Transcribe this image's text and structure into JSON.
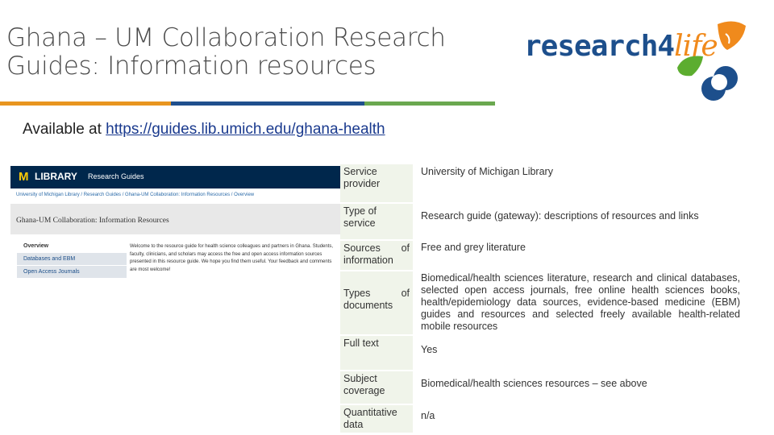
{
  "slide": {
    "title_line1": "Ghana – UM Collaboration Research",
    "title_line2": "Guides: Information resources",
    "available_prefix": "Available at ",
    "available_link": "https://guides.lib.umich.edu/ghana-health"
  },
  "logo": {
    "text_main": "research4",
    "text_accent": "life",
    "icon": "leaf-flower-icon"
  },
  "colors": {
    "rule_orange": "#e8951f",
    "rule_blue": "#1f4f8d",
    "rule_green": "#6aa84f",
    "library_navy": "#00274c",
    "library_maize": "#ffcb05"
  },
  "library_site": {
    "brand_m": "M",
    "brand_library": "LIBRARY",
    "brand_section": "Research Guides",
    "breadcrumb": "University of Michigan Library  /  Research Guides  /  Ghana-UM Collaboration: Information Resources  /  Overview",
    "page_heading": "Ghana-UM Collaboration: Information Resources",
    "nav": [
      "Overview",
      "Databases and EBM",
      "Open Access Journals"
    ],
    "welcome": "Welcome to the resource guide for health science colleagues and partners in Ghana. Students, faculty, clinicians, and scholars may access the free and open access information sources presented in this resource guide. We hope you find them useful. Your feedback and comments are most welcome!"
  },
  "info_table": [
    {
      "key": "Service provider",
      "value": "University of Michigan Library"
    },
    {
      "key": "Type of service",
      "value": "Research guide (gateway): descriptions of resources and links"
    },
    {
      "key": "Sources of information",
      "value": "Free and grey literature"
    },
    {
      "key": "Types of documents",
      "value": "Biomedical/health sciences literature, research and clinical databases, selected open access journals, free online health sciences books, health/epidemiology data sources, evidence-based medicine (EBM) guides and resources and selected freely available health-related mobile resources"
    },
    {
      "key": "Full text",
      "value": "Yes"
    },
    {
      "key": "Subject coverage",
      "value": "Biomedical/health sciences resources – see above"
    },
    {
      "key": "Quantitative data",
      "value": "n/a"
    }
  ]
}
